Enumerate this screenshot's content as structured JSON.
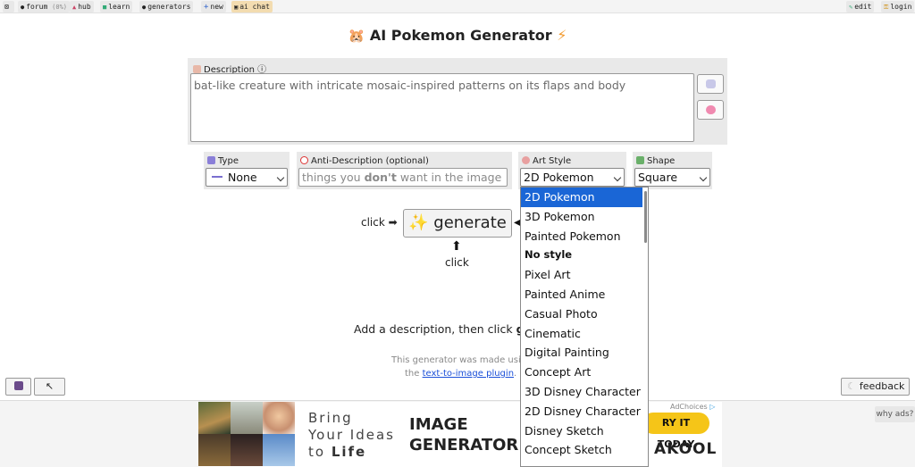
{
  "nav": {
    "forum": "forum",
    "forum_count": "(0%)",
    "hub": "hub",
    "learn": "learn",
    "generators": "generators",
    "new": "new",
    "ai_chat": "ai chat",
    "edit": "edit",
    "login": "login"
  },
  "page": {
    "title": "AI Pokemon Generator"
  },
  "description": {
    "label": "Description",
    "info_glyph": "ⓘ",
    "value": "bat-like creature with intricate mosaic-inspired patterns on its flaps and body"
  },
  "type_field": {
    "label": "Type",
    "value": "None"
  },
  "anti_description": {
    "label": "Anti-Description (optional)",
    "placeholder_pre": "things you ",
    "placeholder_bold": "don't",
    "placeholder_post": " want in the image"
  },
  "art_style": {
    "label": "Art Style",
    "value": "2D Pokemon",
    "options": [
      {
        "label": "2D Pokemon",
        "selected": true,
        "bold": false
      },
      {
        "label": "3D Pokemon",
        "selected": false,
        "bold": false
      },
      {
        "label": "Painted Pokemon",
        "selected": false,
        "bold": false
      },
      {
        "label": "No style",
        "selected": false,
        "bold": true
      },
      {
        "label": "Pixel Art",
        "selected": false,
        "bold": false
      },
      {
        "label": "Painted Anime",
        "selected": false,
        "bold": false
      },
      {
        "label": "Casual Photo",
        "selected": false,
        "bold": false
      },
      {
        "label": "Cinematic",
        "selected": false,
        "bold": false
      },
      {
        "label": "Digital Painting",
        "selected": false,
        "bold": false
      },
      {
        "label": "Concept Art",
        "selected": false,
        "bold": false
      },
      {
        "label": "3D Disney Character",
        "selected": false,
        "bold": false
      },
      {
        "label": "2D Disney Character",
        "selected": false,
        "bold": false
      },
      {
        "label": "Disney Sketch",
        "selected": false,
        "bold": false
      },
      {
        "label": "Concept Sketch",
        "selected": false,
        "bold": false
      }
    ]
  },
  "shape": {
    "label": "Shape",
    "value": "Square"
  },
  "generate": {
    "label": "generate",
    "click_left": "click",
    "click_below": "click"
  },
  "hint": {
    "pre": "Add a description, then click ",
    "bold": "ge"
  },
  "footer_note": {
    "line1": "This generator was made using",
    "line2_pre": "the ",
    "link": "text-to-image plugin",
    "line2_post": "."
  },
  "feedback": {
    "label": "feedback"
  },
  "ad": {
    "line1": "Bring",
    "line2": "Your Ideas",
    "line3_pre": "to ",
    "line3_bold": "Life",
    "headline1": "IMAGE",
    "headline2": "GENERATOR",
    "cta": "RY IT TODAY",
    "brand": "AKOOL",
    "adchoices": "AdChoices",
    "why_ads": "why ads?"
  },
  "colors": {
    "accent_blue": "#1a66d6",
    "link_blue": "#1a4fd8",
    "ad_cta_yellow": "#f5c518",
    "panel_gray": "#e9e9e9"
  }
}
